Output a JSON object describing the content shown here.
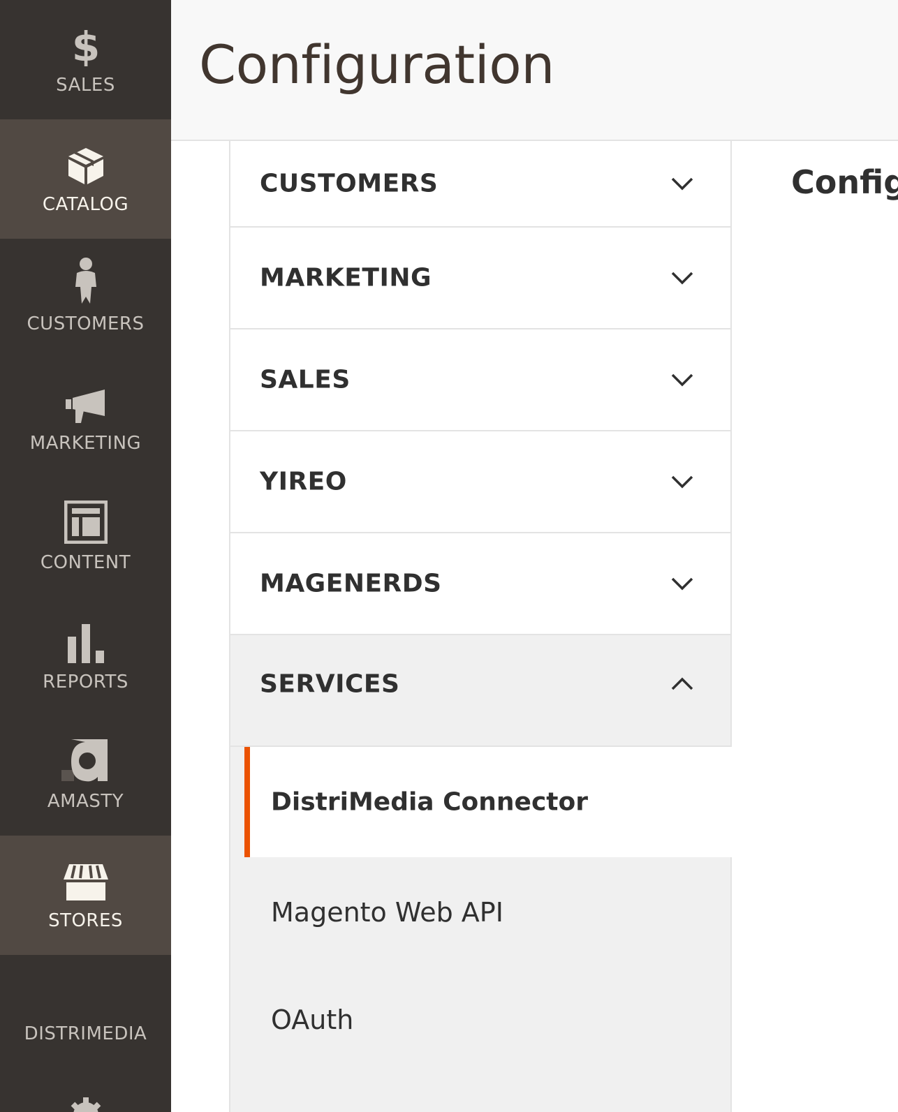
{
  "sidebar": {
    "items": [
      {
        "label": "SALES",
        "icon": "dollar-icon",
        "active": false
      },
      {
        "label": "CATALOG",
        "icon": "box-icon",
        "active": true
      },
      {
        "label": "CUSTOMERS",
        "icon": "person-icon",
        "active": false
      },
      {
        "label": "MARKETING",
        "icon": "megaphone-icon",
        "active": false
      },
      {
        "label": "CONTENT",
        "icon": "layout-icon",
        "active": false
      },
      {
        "label": "REPORTS",
        "icon": "bar-chart-icon",
        "active": false
      },
      {
        "label": "AMASTY",
        "icon": "amasty-logo-icon",
        "active": false
      },
      {
        "label": "STORES",
        "icon": "storefront-icon",
        "active": true
      },
      {
        "label": "DISTRIMEDIA",
        "icon": "",
        "active": false
      }
    ],
    "partial_bottom_icon": "gear-icon"
  },
  "header": {
    "title": "Configuration"
  },
  "config_tabs": {
    "groups": [
      {
        "label": "CUSTOMERS",
        "state": "collapsed",
        "chevron": "chevron-down-icon"
      },
      {
        "label": "MARKETING",
        "state": "collapsed",
        "chevron": "chevron-down-icon"
      },
      {
        "label": "SALES",
        "state": "collapsed",
        "chevron": "chevron-down-icon"
      },
      {
        "label": "YIREO",
        "state": "collapsed",
        "chevron": "chevron-down-icon"
      },
      {
        "label": "MAGENERDS",
        "state": "collapsed",
        "chevron": "chevron-down-icon"
      },
      {
        "label": "SERVICES",
        "state": "expanded",
        "chevron": "chevron-up-icon"
      }
    ],
    "services_items": [
      {
        "label": "DistriMedia Connector",
        "active": true
      },
      {
        "label": "Magento Web API",
        "active": false
      },
      {
        "label": "OAuth",
        "active": false
      }
    ]
  },
  "main": {
    "heading": "Config"
  },
  "colors": {
    "sidebar_bg": "#373330",
    "sidebar_active_bg": "#514943",
    "accent": "#eb5202",
    "header_bg": "#f8f8f8",
    "open_group_bg": "#f0f0f0"
  }
}
